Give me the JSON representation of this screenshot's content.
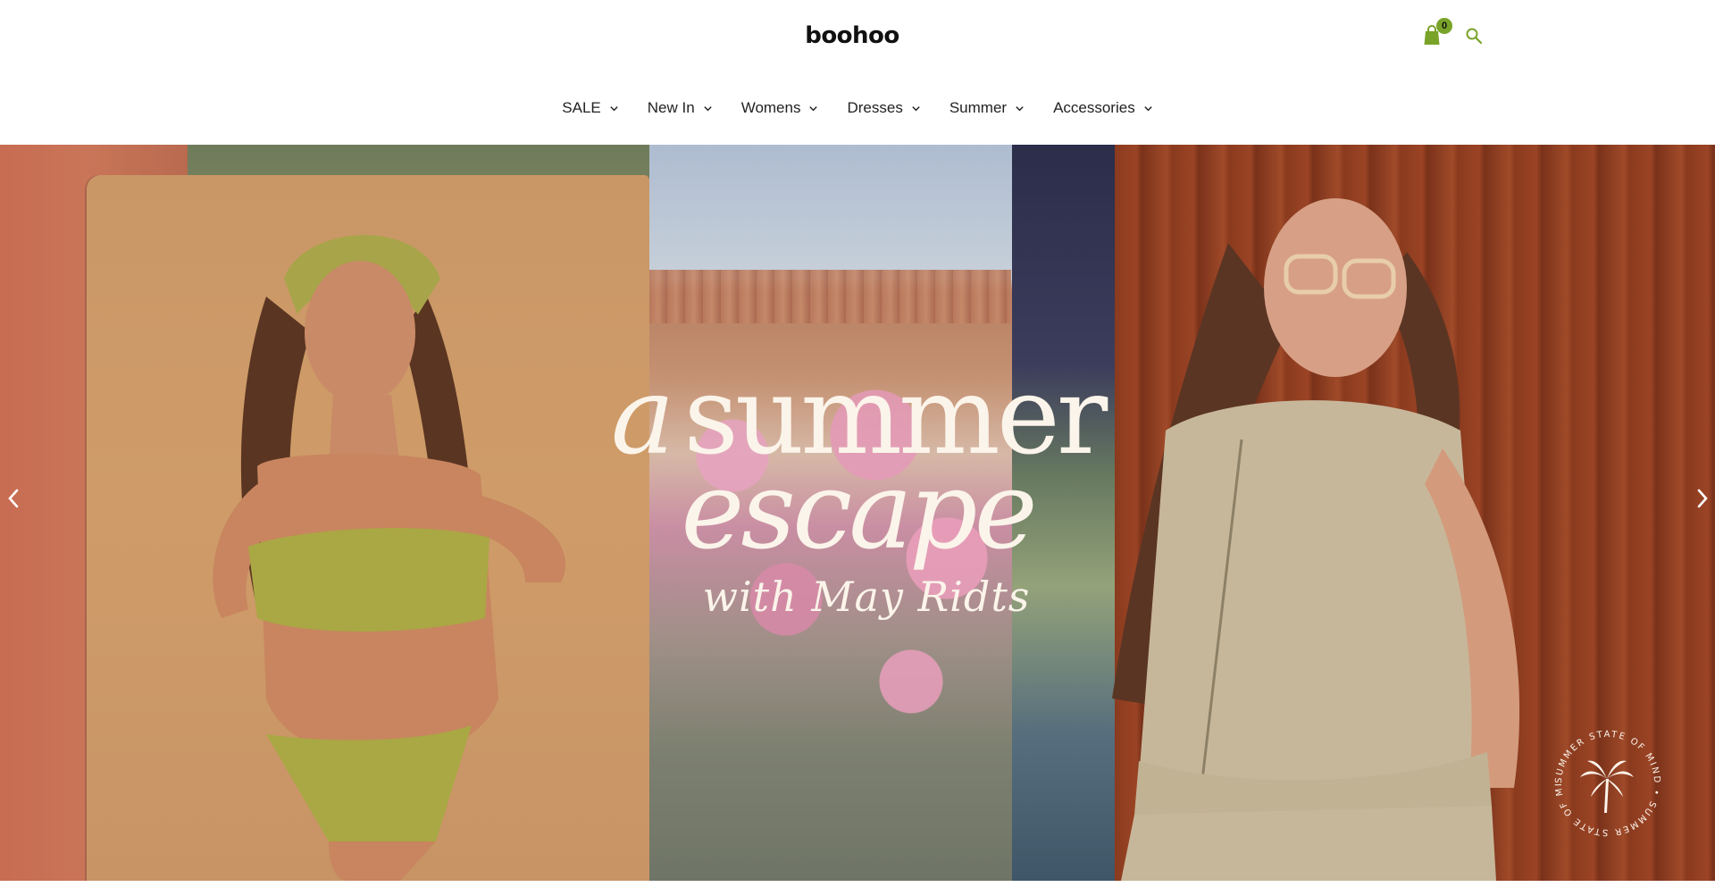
{
  "brand": {
    "logo_text": "boohoo",
    "accent_color": "#7aa32a"
  },
  "header": {
    "cart": {
      "icon": "shopping-bag-icon",
      "count": "0"
    },
    "search": {
      "icon": "search-icon"
    }
  },
  "nav": {
    "items": [
      {
        "label": "SALE",
        "icon": "chevron-down-icon"
      },
      {
        "label": "New In",
        "icon": "chevron-down-icon"
      },
      {
        "label": "Womens",
        "icon": "chevron-down-icon"
      },
      {
        "label": "Dresses",
        "icon": "chevron-down-icon"
      },
      {
        "label": "Summer",
        "icon": "chevron-down-icon"
      },
      {
        "label": "Accessories",
        "icon": "chevron-down-icon"
      }
    ]
  },
  "hero": {
    "headline_word_a": "a",
    "headline_word_summer": "summer",
    "headline_line2": "escape",
    "headline_line3": "with May Ridts",
    "seal_text": "SUMMER STATE OF MIND • SUMMER STATE OF MIND •",
    "prev_icon": "chevron-left-icon",
    "next_icon": "chevron-right-icon",
    "seal_icon": "palm-tree-icon"
  }
}
